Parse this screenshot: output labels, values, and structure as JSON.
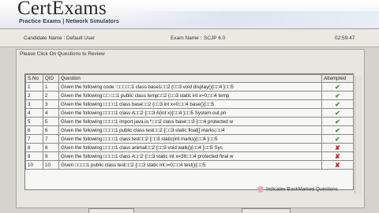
{
  "app": {
    "logo_title": "CertExams",
    "logo_subtitle": "Practice Exams | Network Simulators"
  },
  "info": {
    "candidate_label": "Candidate Name :",
    "candidate_value": "Default User",
    "exam_label": "Exam Name :",
    "exam_value": "SCJP 6.0",
    "timer": "02:59:47"
  },
  "panel": {
    "caption": "Please Click On Questions to Review"
  },
  "table": {
    "headers": [
      "S.No",
      "QID",
      "Question",
      "Attempted"
    ],
    "rows": [
      {
        "sno": "1",
        "qid": "1",
        "question": "Given the following code: □□□□□1     class base1□□2     {□□3     void display(){□□4     }□□5",
        "attempted": "✔",
        "status": "yes"
      },
      {
        "sno": "2",
        "qid": "2",
        "question": "Given the following:□□   □□1     public class temp□□2     {□□3     static int x=0;□□4     temp",
        "attempted": "✔",
        "status": "yes"
      },
      {
        "sno": "3",
        "qid": "3",
        "question": "Given the following:□□□□1     class base□□2     {□□3     int x=0;□□4     base(){□□5",
        "attempted": "✔",
        "status": "yes"
      },
      {
        "sno": "4",
        "qid": "4",
        "question": "Given the following:□□□□1     class A□□2     {□□3     A(int x){□□4     }□□5     System.out.pri",
        "attempted": "✔",
        "status": "yes"
      },
      {
        "sno": "5",
        "qid": "5",
        "question": "Given the following:□□□□1     import java.io.*;□□2     class base□□3     {□□4     protected w",
        "attempted": "✔",
        "status": "yes"
      },
      {
        "sno": "6",
        "qid": "6",
        "question": "Given the following:□□□□1     public class test□□2     {□□3     static float[] marks;□□4",
        "attempted": "✔",
        "status": "yes"
      },
      {
        "sno": "7",
        "qid": "7",
        "question": "Given the following:□□□□1     class test□□2     {□□3     static(int marks){□□4     }□□5",
        "attempted": "✔",
        "status": "yes"
      },
      {
        "sno": "8",
        "qid": "8",
        "question": "Given the following:□□□□1     class animal□□2     {□□3     void walk(){□□4     }□□5     Sys",
        "attempted": "✘",
        "status": "no"
      },
      {
        "sno": "9",
        "qid": "9",
        "question": "Given the following:□□□□1     class A□□2     {□□3     static int x=38;□□4     protected final w",
        "attempted": "✘",
        "status": "no"
      },
      {
        "sno": "10",
        "qid": "10",
        "question": "Given □□□□1     public class test□□2     {□□3     static int i=0;□□4     test(){□□5",
        "attempted": "✘",
        "status": "no"
      }
    ]
  },
  "legend": {
    "text": "Indicates BookMarked Questions"
  }
}
